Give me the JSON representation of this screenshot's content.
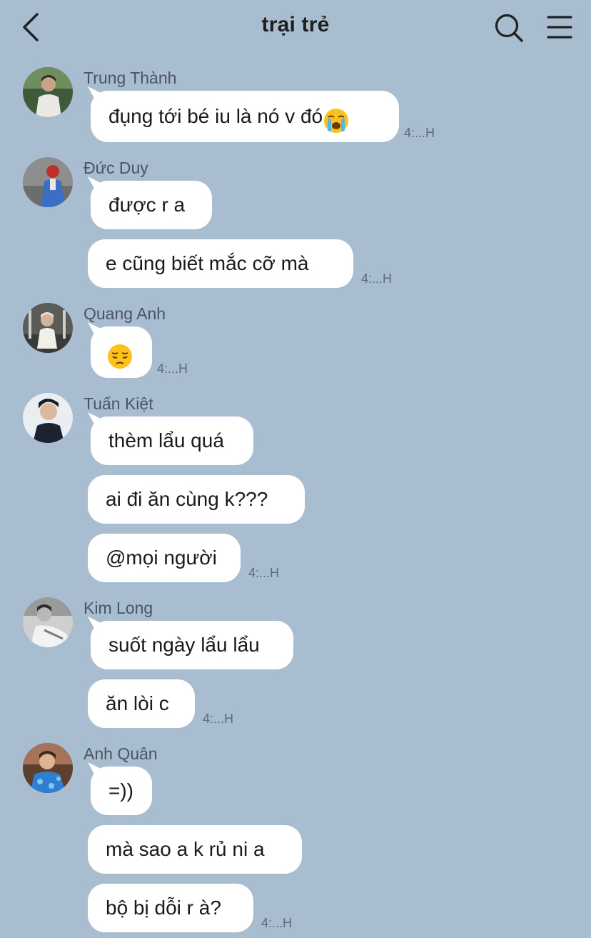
{
  "header": {
    "title": "trại trẻ"
  },
  "messages": [
    {
      "sender": "Trung Thành",
      "bubbles": [
        "đụng tới bé iu là nó v đó"
      ],
      "time": "4:...H"
    },
    {
      "sender": "Đức Duy",
      "bubbles": [
        "được r a",
        "e cũng biết mắc cỡ mà"
      ],
      "time": "4:...H"
    },
    {
      "sender": "Quang Anh",
      "bubbles": [
        ""
      ],
      "time": "4:...H"
    },
    {
      "sender": "Tuấn Kiệt",
      "bubbles": [
        "thèm lẩu quá",
        "ai đi ăn cùng k???",
        "@mọi người"
      ],
      "time": "4:...H"
    },
    {
      "sender": "Kim Long",
      "bubbles": [
        "suốt ngày lẩu lẩu",
        "ăn lòi c"
      ],
      "time": "4:...H"
    },
    {
      "sender": "Anh Quân",
      "bubbles": [
        "=))",
        "mà sao a k rủ ni a",
        "bộ bị dỗi r à?"
      ],
      "time": "4:...H"
    }
  ],
  "icons": {
    "back": "chevron-left-icon",
    "search": "search-icon",
    "menu": "menu-icon",
    "crying_emoji": "loudly-crying-face-emoji",
    "pensive_emoji": "pensive-face-emoji"
  },
  "colors": {
    "background": "#a9bdd1",
    "bubble": "#ffffff",
    "title": "#1f1f1f",
    "sender": "#4a5561",
    "time": "#5f6b77"
  }
}
